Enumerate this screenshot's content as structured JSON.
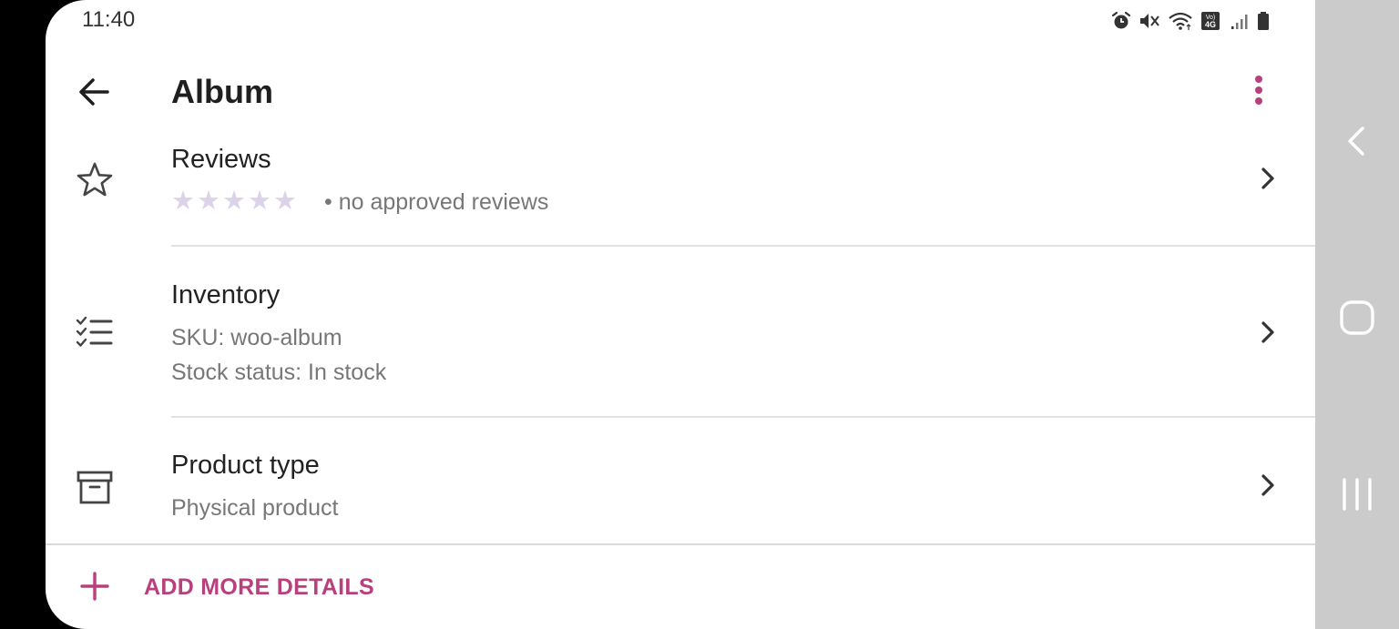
{
  "status_bar": {
    "time": "11:40",
    "icons": [
      "alarm-icon",
      "mute-icon",
      "wifi-icon",
      "volte-4g-icon",
      "signal-icon",
      "battery-icon"
    ]
  },
  "app_bar": {
    "title": "Album",
    "back_icon": "arrow-left-icon",
    "more_icon": "more-vertical-icon"
  },
  "rows": {
    "reviews": {
      "icon": "star-outline-icon",
      "title": "Reviews",
      "stars": [
        "★",
        "★",
        "★",
        "★",
        "★"
      ],
      "subtitle": "• no approved reviews"
    },
    "inventory": {
      "icon": "checklist-icon",
      "title": "Inventory",
      "sku": "SKU: woo-album",
      "stock": "Stock status: In stock"
    },
    "product_type": {
      "icon": "archive-box-icon",
      "title": "Product type",
      "subtitle": "Physical product"
    }
  },
  "footer": {
    "add_label": "ADD MORE DETAILS",
    "add_icon": "plus-icon"
  },
  "nav_bar": {
    "buttons": [
      "back-nav-icon",
      "home-nav-icon",
      "recents-nav-icon"
    ]
  },
  "colors": {
    "accent": "#b8407c",
    "star_empty": "#dcd3ea",
    "nav_background": "#cbcbcb"
  }
}
